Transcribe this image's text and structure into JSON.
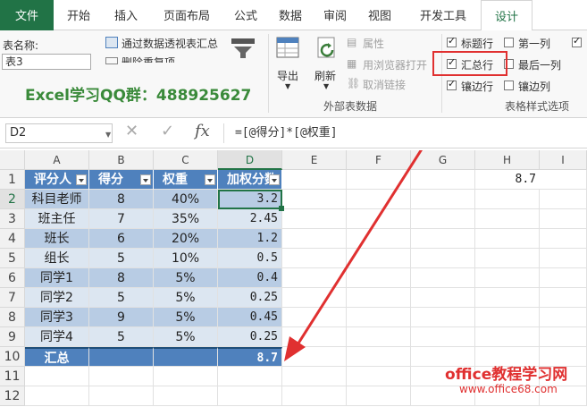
{
  "tabs": [
    "文件",
    "开始",
    "插入",
    "页面布局",
    "公式",
    "数据",
    "审阅",
    "视图",
    "开发工具",
    "设计"
  ],
  "ribbon": {
    "table_name_label": "表名称:",
    "table_name_value": "表3",
    "pivot_summary": "通过数据透视表汇总",
    "remove_duplicates": "删除重复项",
    "export_label": "导出",
    "refresh_label": "刷新",
    "properties_label": "属性",
    "open_in_browser": "用浏览器打开",
    "unlink": "取消链接",
    "external_group": "外部表数据",
    "header_row": "标题行",
    "first_column": "第一列",
    "total_row": "汇总行",
    "last_column": "最后一列",
    "banded_rows": "镶边行",
    "banded_columns": "镶边列",
    "style_group": "表格样式选项",
    "watermark": "Excel学习QQ群：488925627",
    "states": {
      "header_row": true,
      "first_column": false,
      "total_row": true,
      "last_column": false,
      "banded_rows": true,
      "banded_columns": false
    }
  },
  "formula_bar": {
    "name_box": "D2",
    "formula": "=[@得分]*[@权重]",
    "fx": "fx"
  },
  "columns": [
    "A",
    "B",
    "C",
    "D",
    "E",
    "F",
    "G",
    "H",
    "I"
  ],
  "rows": [
    "1",
    "2",
    "3",
    "4",
    "5",
    "6",
    "7",
    "8",
    "9",
    "10",
    "11",
    "12"
  ],
  "table": {
    "headers": [
      "评分人",
      "得分",
      "权重",
      "加权分数"
    ],
    "rows": [
      [
        "科目老师",
        "8",
        "40%",
        "3.2"
      ],
      [
        "班主任",
        "7",
        "35%",
        "2.45"
      ],
      [
        "班长",
        "6",
        "20%",
        "1.2"
      ],
      [
        "组长",
        "5",
        "10%",
        "0.5"
      ],
      [
        "同学1",
        "8",
        "5%",
        "0.4"
      ],
      [
        "同学2",
        "5",
        "5%",
        "0.25"
      ],
      [
        "同学3",
        "9",
        "5%",
        "0.45"
      ],
      [
        "同学4",
        "5",
        "5%",
        "0.25"
      ]
    ],
    "total_label": "汇总",
    "total_value": "8.7"
  },
  "h1_value": "8.7",
  "watermark_site": "office教程学习网",
  "watermark_url": "www.office68.com",
  "colors": {
    "accent": "#217346",
    "table_header": "#4f81bd",
    "band_dark": "#b8cce4",
    "band_light": "#dce6f1",
    "annotation": "#e03030"
  }
}
